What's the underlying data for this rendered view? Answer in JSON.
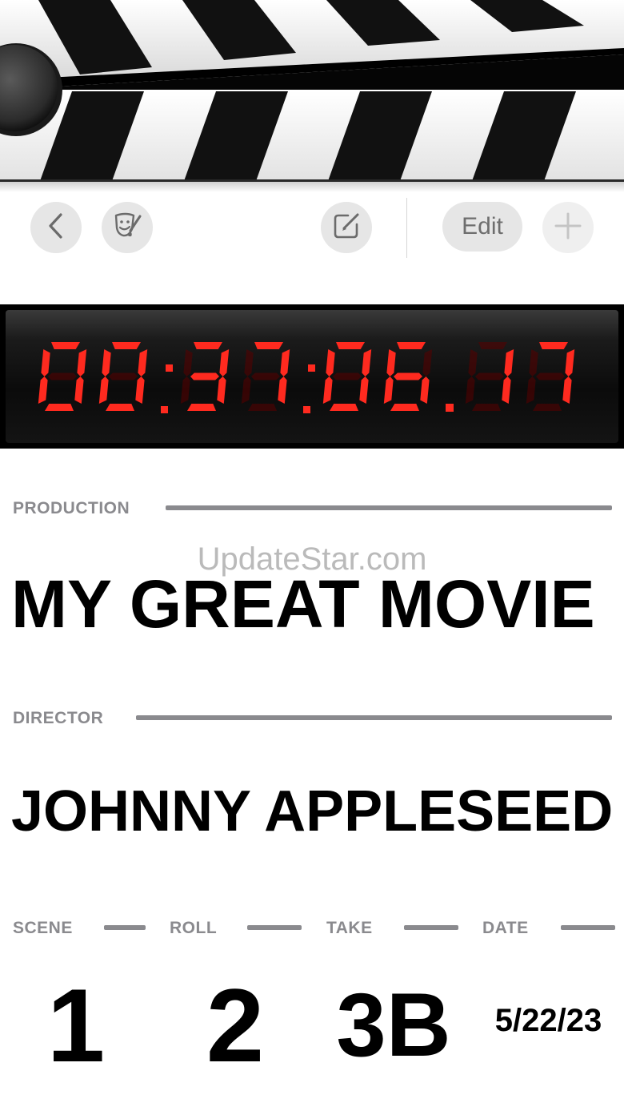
{
  "toolbar": {
    "back_icon": "chevron-left-icon",
    "theme_icon": "theater-masks-brush-icon",
    "compose_icon": "compose-icon",
    "edit_label": "Edit",
    "add_icon": "plus-icon"
  },
  "timecode": {
    "value": "00:37:06.17",
    "color": "#ff2a1f"
  },
  "watermark": "UpdateStar.com",
  "production": {
    "label": "PRODUCTION",
    "value": "MY GREAT MOVIE"
  },
  "director": {
    "label": "DIRECTOR",
    "value": "JOHNNY APPLESEED"
  },
  "slate": {
    "scene_label": "SCENE",
    "scene": "1",
    "roll_label": "ROLL",
    "roll": "2",
    "take_label": "TAKE",
    "take": "3B",
    "date_label": "DATE",
    "date": "5/22/23"
  }
}
